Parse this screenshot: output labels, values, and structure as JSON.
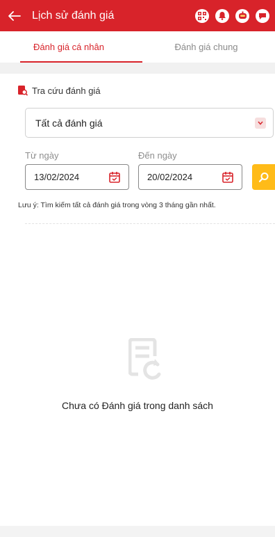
{
  "header": {
    "title": "Lịch sử đánh giá",
    "icons": [
      "arrow-left-icon",
      "qr-code-icon",
      "bell-icon",
      "robot-icon",
      "chat-icon"
    ]
  },
  "colors": {
    "primary": "#d8232a",
    "search_button": "#ffbb18"
  },
  "tabs": [
    {
      "label": "Đánh giá cá nhân",
      "active": true
    },
    {
      "label": "Đánh giá chung",
      "active": false
    }
  ],
  "search": {
    "section_title": "Tra cứu đánh giá",
    "type_select_value": "Tất cả đánh giá",
    "from_label": "Từ ngày",
    "from_value": "13/02/2024",
    "to_label": "Đến ngày",
    "to_value": "20/02/2024",
    "note": "Lưu ý: Tìm kiếm tất cả đánh giá trong vòng 3 tháng gần nhất."
  },
  "empty_state": {
    "message": "Chưa có Đánh giá trong danh sách"
  }
}
